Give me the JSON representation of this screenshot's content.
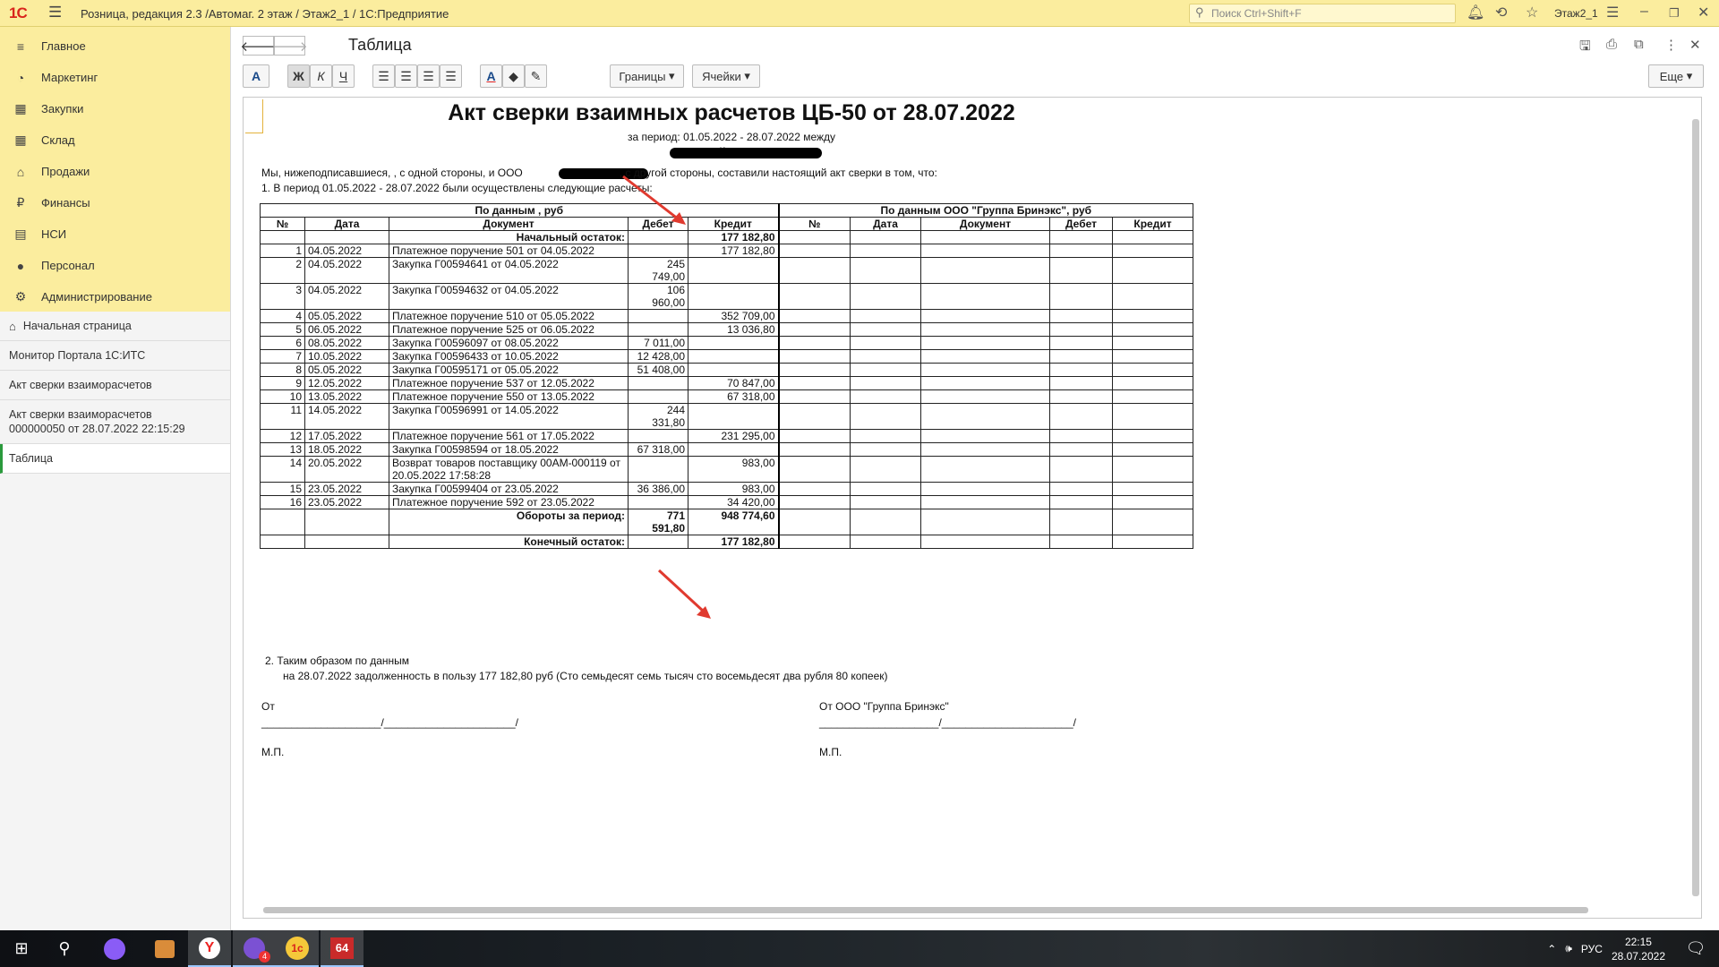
{
  "titlebar": {
    "logo": "1С",
    "title": "Розница, редакция 2.3 /Автомаг. 2 этаж / Этаж2_1 / 1С:Предприятие",
    "search_placeholder": "Поиск Ctrl+Shift+F",
    "user": "Этаж2_1"
  },
  "sections": [
    {
      "label": "Главное",
      "icon": "≡"
    },
    {
      "label": "Маркетинг",
      "icon": "◔"
    },
    {
      "label": "Закупки",
      "icon": "▦"
    },
    {
      "label": "Склад",
      "icon": "▦"
    },
    {
      "label": "Продажи",
      "icon": "⌂"
    },
    {
      "label": "Финансы",
      "icon": "₽"
    },
    {
      "label": "НСИ",
      "icon": "▤"
    },
    {
      "label": "Персонал",
      "icon": "●"
    },
    {
      "label": "Администрирование",
      "icon": "⚙"
    }
  ],
  "open_windows": {
    "home": "Начальная страница",
    "items": [
      "Монитор Портала 1С:ИТС",
      "Акт сверки взаиморасчетов",
      "Акт сверки взаиморасчетов",
      "000000050 от 28.07.2022 22:15:29",
      "Таблица"
    ]
  },
  "doc_header": {
    "title": "Таблица"
  },
  "toolbar": {
    "font_btn": "A",
    "bold": "Ж",
    "italic": "К",
    "underline": "Ч",
    "borders": "Границы",
    "cells": "Ячейки",
    "more": "Еще"
  },
  "document": {
    "title": "Акт сверки взаимных расчетов ЦБ-50 от 28.07.2022",
    "period": "за период: 01.05.2022 - 28.07.2022 между",
    "and": "и",
    "intro1": "Мы, нижеподписавшиеся, , с одной стороны, и  ООО",
    "intro1b": ", с другой стороны, составили настоящий акт сверки в том, что:",
    "intro2": "1. В период 01.05.2022 - 28.07.2022 были осуществлены следующие расчеты:",
    "group_left": "По данным , руб",
    "group_right": "По данным ООО \"Группа Бринэкс\", руб",
    "columns": [
      "№",
      "Дата",
      "Документ",
      "Дебет",
      "Кредит"
    ],
    "opening_label": "Начальный остаток:",
    "opening_credit": "177 182,80",
    "rows": [
      {
        "n": "1",
        "date": "04.05.2022",
        "doc": "Платежное поручение 501 от 04.05.2022",
        "debit": "",
        "credit": "177 182,80"
      },
      {
        "n": "2",
        "date": "04.05.2022",
        "doc": "Закупка Г00594641 от 04.05.2022",
        "debit": "245 749,00",
        "credit": ""
      },
      {
        "n": "3",
        "date": "04.05.2022",
        "doc": "Закупка Г00594632 от 04.05.2022",
        "debit": "106 960,00",
        "credit": ""
      },
      {
        "n": "4",
        "date": "05.05.2022",
        "doc": "Платежное поручение 510 от 05.05.2022",
        "debit": "",
        "credit": "352 709,00"
      },
      {
        "n": "5",
        "date": "06.05.2022",
        "doc": "Платежное поручение 525 от 06.05.2022",
        "debit": "",
        "credit": "13 036,80"
      },
      {
        "n": "6",
        "date": "08.05.2022",
        "doc": "Закупка Г00596097 от 08.05.2022",
        "debit": "7 011,00",
        "credit": ""
      },
      {
        "n": "7",
        "date": "10.05.2022",
        "doc": "Закупка Г00596433 от 10.05.2022",
        "debit": "12 428,00",
        "credit": ""
      },
      {
        "n": "8",
        "date": "05.05.2022",
        "doc": "Закупка Г00595171 от 05.05.2022",
        "debit": "51 408,00",
        "credit": ""
      },
      {
        "n": "9",
        "date": "12.05.2022",
        "doc": "Платежное поручение 537 от 12.05.2022",
        "debit": "",
        "credit": "70 847,00"
      },
      {
        "n": "10",
        "date": "13.05.2022",
        "doc": "Платежное поручение 550 от 13.05.2022",
        "debit": "",
        "credit": "67 318,00"
      },
      {
        "n": "11",
        "date": "14.05.2022",
        "doc": "Закупка Г00596991 от 14.05.2022",
        "debit": "244 331,80",
        "credit": ""
      },
      {
        "n": "12",
        "date": "17.05.2022",
        "doc": "Платежное поручение 561 от 17.05.2022",
        "debit": "",
        "credit": "231 295,00"
      },
      {
        "n": "13",
        "date": "18.05.2022",
        "doc": "Закупка Г00598594 от 18.05.2022",
        "debit": "67 318,00",
        "credit": ""
      },
      {
        "n": "14",
        "date": "20.05.2022",
        "doc": "Возврат товаров поставщику 00АМ-000119 от 20.05.2022 17:58:28",
        "debit": "",
        "credit": "983,00"
      },
      {
        "n": "15",
        "date": "23.05.2022",
        "doc": "Закупка Г00599404 от 23.05.2022",
        "debit": "36 386,00",
        "credit": "983,00"
      },
      {
        "n": "16",
        "date": "23.05.2022",
        "doc": "Платежное поручение 592 от 23.05.2022",
        "debit": "",
        "credit": "34 420,00"
      }
    ],
    "turnover_label": "Обороты за период:",
    "turnover_debit": "771 591,80",
    "turnover_credit": "948 774,60",
    "closing_label": "Конечный остаток:",
    "closing_credit": "177 182,80",
    "summary1": "2. Таким образом по данным",
    "summary2": "на 28.07.2022 задолженность в пользу  177 182,80 руб (Сто семьдесят семь тысяч сто восемьдесят два рубля 80 копеек)",
    "sign_left_label": "От",
    "sign_right_label": "От ООО \"Группа Бринэкс\"",
    "sign_line": "____________________/______________________/",
    "stamp": "М.П."
  },
  "taskbar": {
    "lang": "РУС",
    "time": "22:15",
    "date": "28.07.2022",
    "badge": "4",
    "app64": "64"
  },
  "colors": {
    "section_bg": "#fbed9e",
    "accent_green": "#2a9a3c",
    "arrow_red": "#e03a2f",
    "logo_red": "#d9251c"
  }
}
